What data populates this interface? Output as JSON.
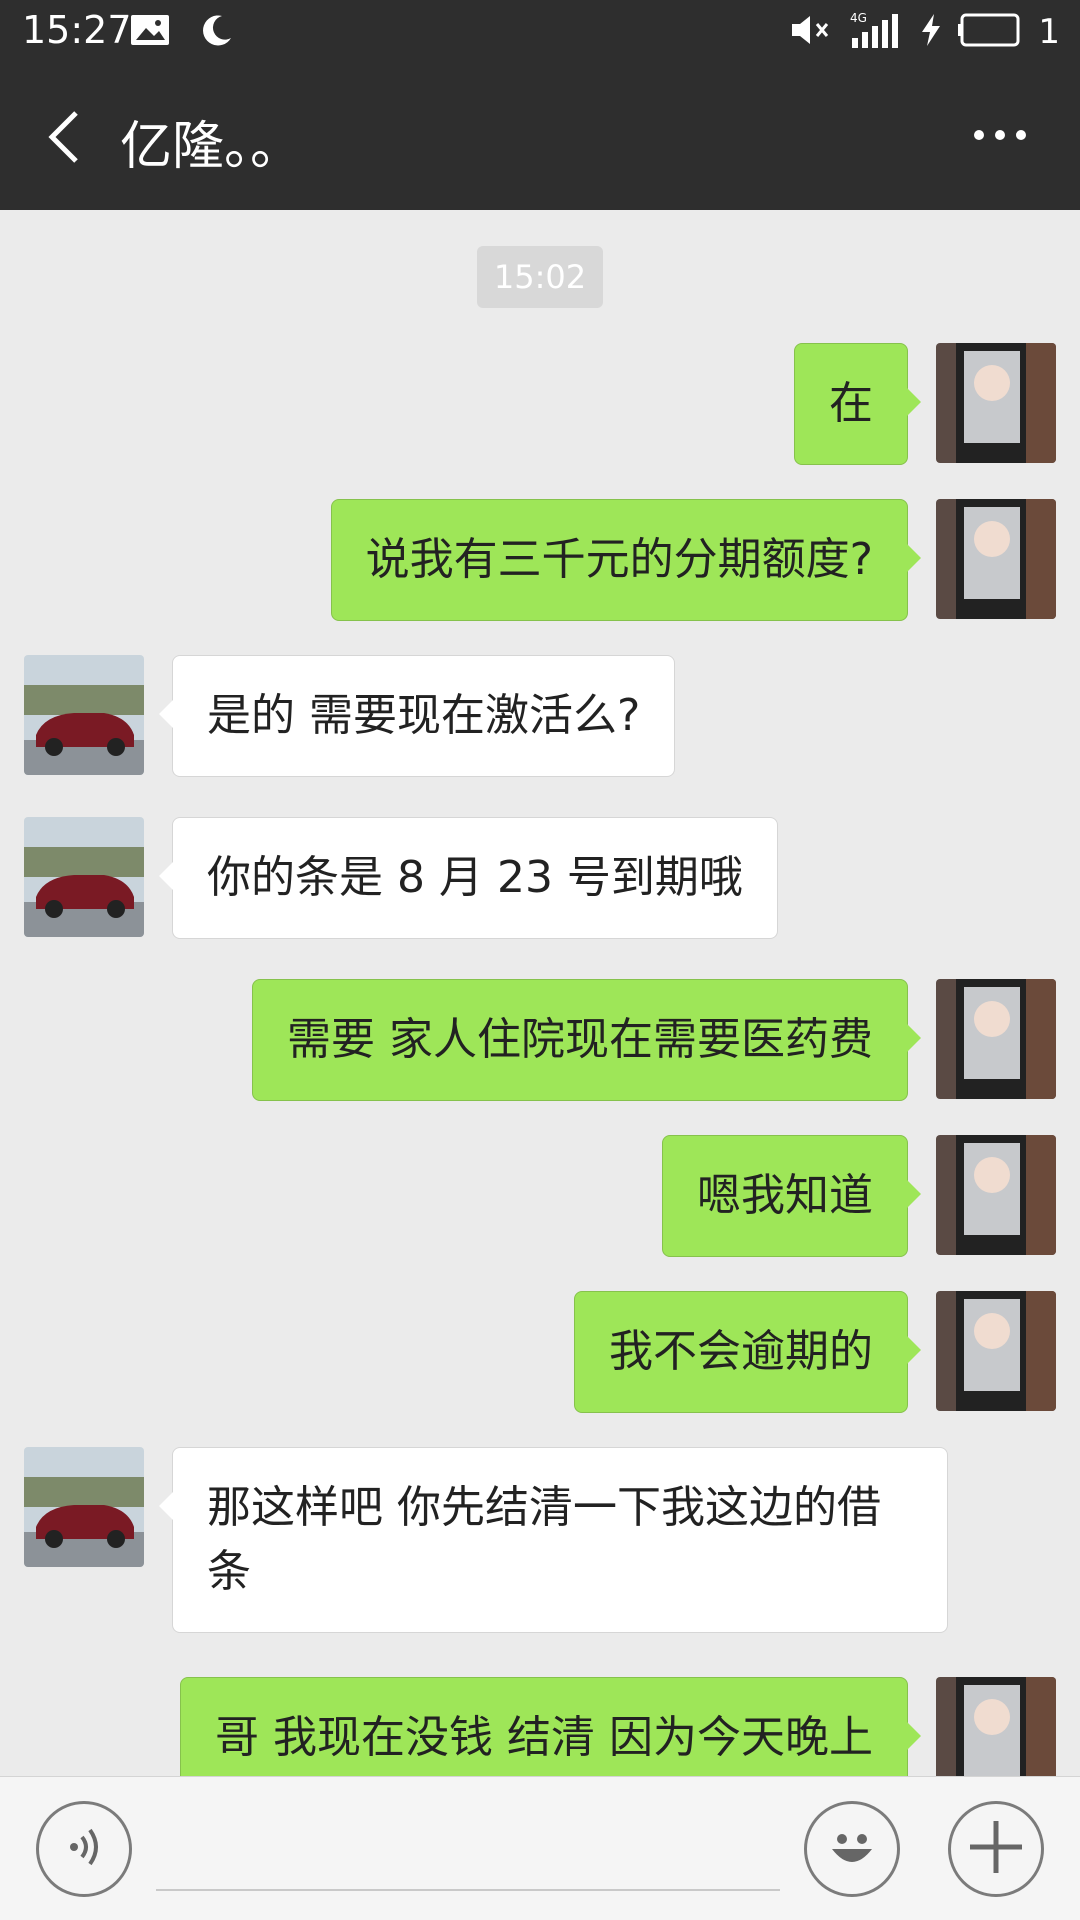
{
  "status_bar": {
    "time": "15:27",
    "network": "4G",
    "battery_level": "1",
    "icons": [
      "image-icon",
      "moon-icon",
      "mute-icon",
      "signal-icon",
      "charging-icon",
      "battery-icon"
    ]
  },
  "header": {
    "title": "亿隆。。",
    "back_icon": "back-arrow-icon",
    "more_icon": "more-icon"
  },
  "chat": {
    "timestamp": "15:02",
    "messages": [
      {
        "side": "right",
        "text": "在"
      },
      {
        "side": "right",
        "text": "说我有三千元的分期额度?"
      },
      {
        "side": "left",
        "text": "是的 需要现在激活么?"
      },
      {
        "side": "left",
        "text": "你的条是 8 月 23 号到期哦"
      },
      {
        "side": "right",
        "text": "需要 家人住院现在需要医药费"
      },
      {
        "side": "right",
        "text": "嗯我知道"
      },
      {
        "side": "right",
        "text": "我不会逾期的"
      },
      {
        "side": "left",
        "text": "那这样吧 你先结清一下我这边的借条"
      },
      {
        "side": "right",
        "text": "哥 我现在没钱 结清 因为今天晚上"
      }
    ]
  },
  "input_bar": {
    "placeholder": "",
    "icons": [
      "voice-icon",
      "emoji-icon",
      "plus-icon"
    ]
  },
  "colors": {
    "bar_bg": "#2e2e2e",
    "chat_bg": "#ebebeb",
    "sent_bubble": "#9ee658",
    "received_bubble": "#ffffff"
  }
}
